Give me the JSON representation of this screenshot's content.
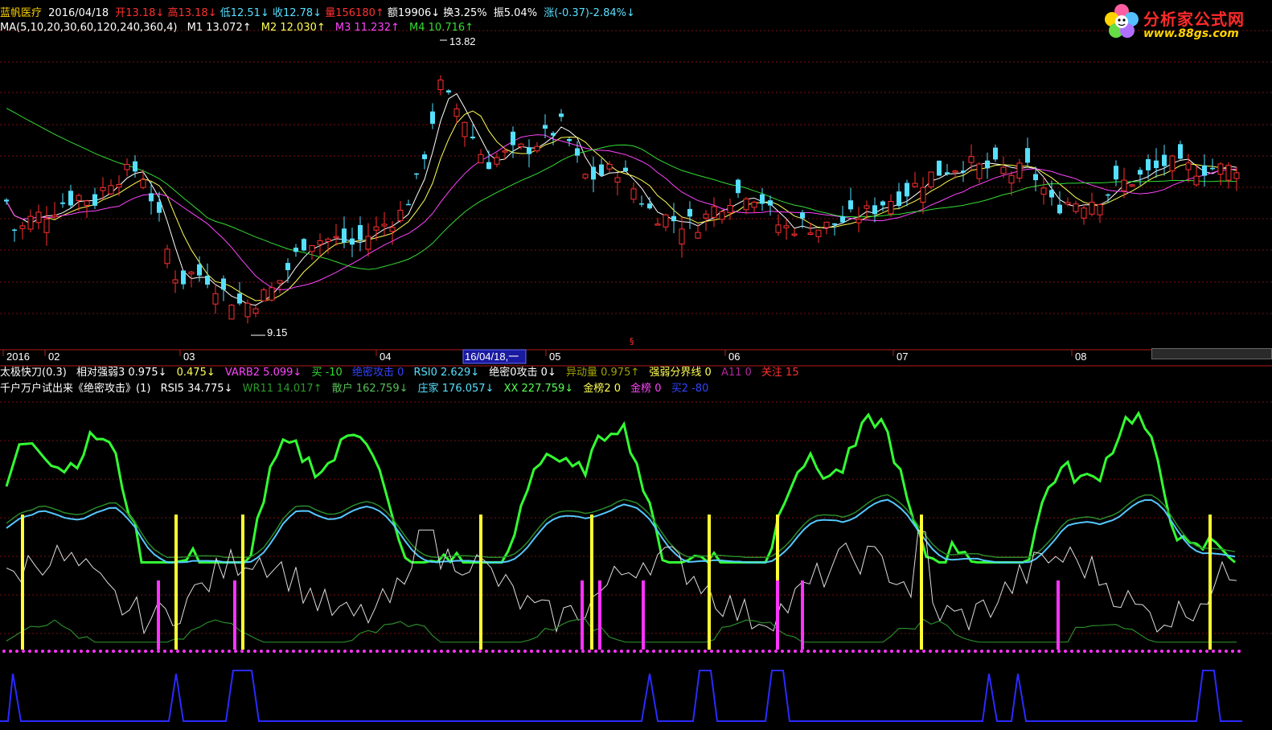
{
  "colors": {
    "up_candle": "#ff3030",
    "down_candle": "#55e0ff",
    "ma1": "#ffffff",
    "ma2": "#ffff55",
    "ma3": "#ff44ff",
    "ma4": "#33dd33",
    "grid": "#7a1010",
    "axis": "#b01c1c"
  },
  "header_line1": {
    "name": "蓝帆医疗",
    "date": "2016/04/18",
    "open": "开13.18↓",
    "high": "高13.18↓",
    "low": "低12.51↓",
    "close": "收12.78↓",
    "volume": "量156180↑",
    "amount": "额19906↓",
    "turnover": "换3.25%",
    "amplitude": "振5.04%",
    "change": "涨(-0.37)-2.84%↓"
  },
  "header_line2": {
    "label": "MA(5,10,20,30,60,120,240,360,4)",
    "m1": "M1 13.072↑",
    "m2": "M2 12.030↑",
    "m3": "M3 11.232↑",
    "m4": "M4 10.716↑"
  },
  "price_annotations": {
    "high_label": "13.82",
    "low_label": "9.15"
  },
  "time_axis": {
    "labels": [
      "2016",
      "02",
      "03",
      "04",
      "05",
      "06",
      "07",
      "08"
    ],
    "cursor_label": "16/04/18,一"
  },
  "indicator_line1": {
    "title": "太极快刀(0.3)",
    "i1": "相对强弱3 0.975↓",
    "i2": "0.475↓",
    "i3": "VARB2 5.099↓",
    "i4": "买 -10",
    "i5": "绝密攻击 0",
    "i6": "RSI0 2.629↓",
    "i7": "绝密0攻击 0↓",
    "i8": "异动量 0.975↑",
    "i9": "强弱分界线 0",
    "i10": "A11 0",
    "i11": "关注 15"
  },
  "indicator_line2": {
    "title": "千户万户试出来《绝密攻击》(1)",
    "j1": "RSI5 34.775↓",
    "j2": "WR11 14.017↑",
    "j3": "散户 162.759↓",
    "j4": "庄家 176.057↓",
    "j5": "XX 227.759↓",
    "j6": "金榜2 0",
    "j7": "金榜 0",
    "j8": "买2 -80"
  },
  "logo": {
    "text": "分析家公式网",
    "url": "www.88gs.com"
  }
}
